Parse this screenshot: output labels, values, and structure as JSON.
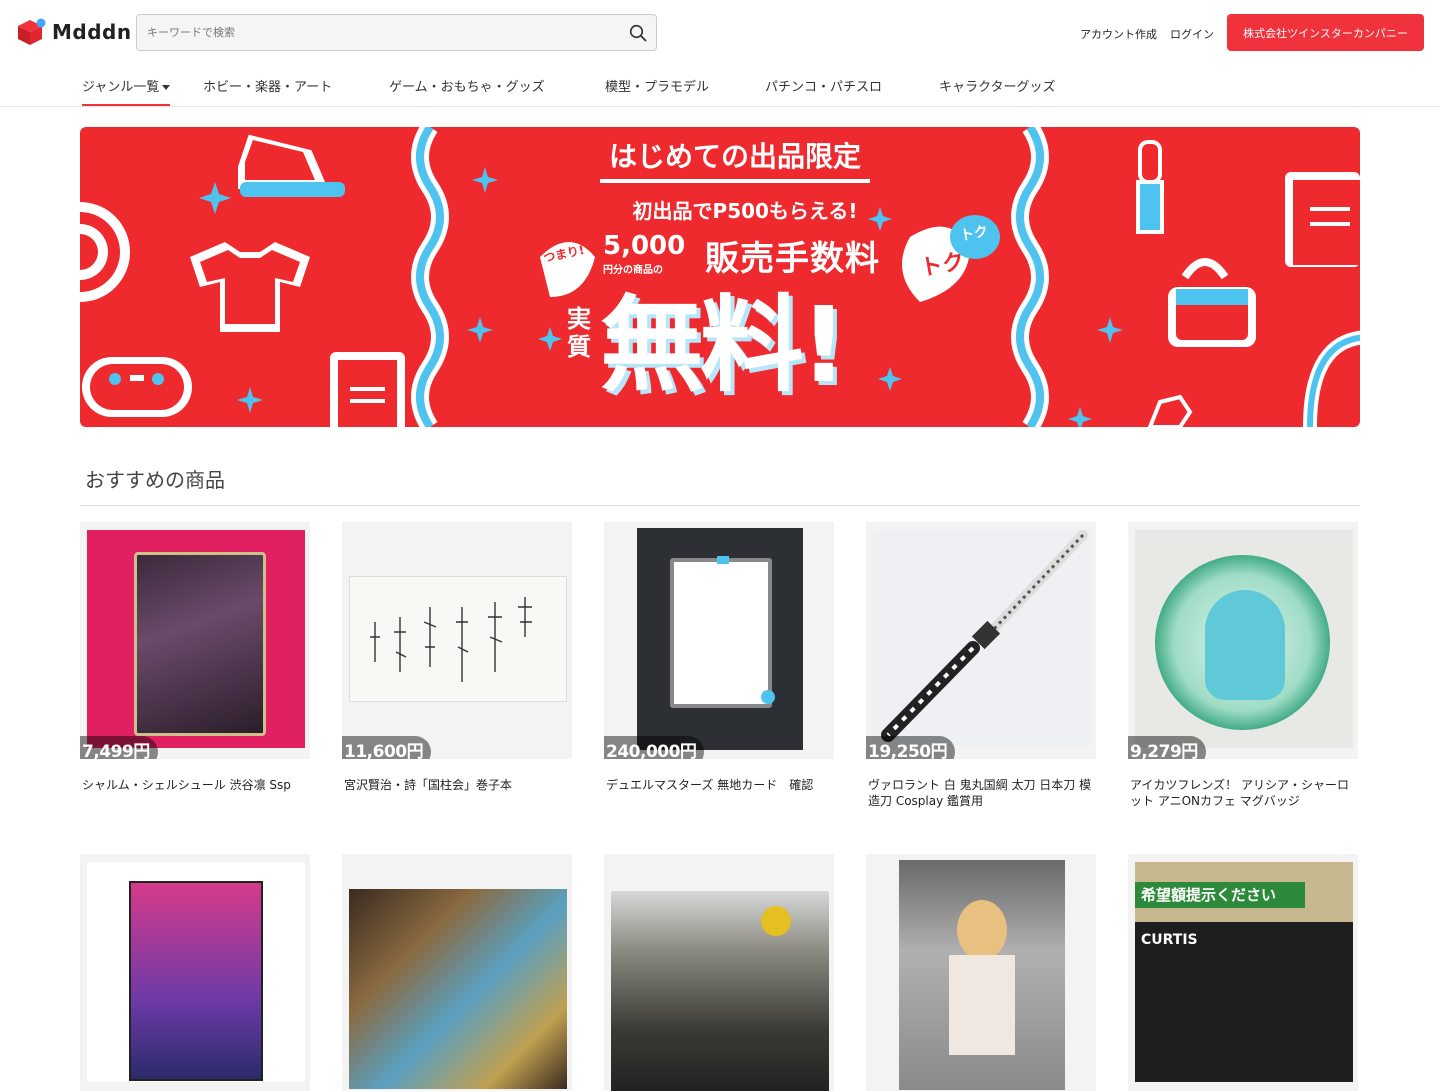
{
  "header": {
    "logo_text": "Mdddn",
    "search_placeholder": "キーワードで検索",
    "account_create": "アカウント作成",
    "login": "ログイン",
    "company_button": "株式会社ツインスターカンパニー"
  },
  "nav": {
    "items": [
      "ジャンル一覧",
      "ホビー・楽器・アート",
      "ゲーム・おもちゃ・グッズ",
      "模型・プラモデル",
      "パチンコ・パチスロ",
      "キャラクターグッズ"
    ]
  },
  "banner": {
    "headline": "はじめての出品限定",
    "line1": "初出品でP500もらえる!",
    "tsumari": "つまり!",
    "amount": "5,000",
    "amount_sub": "円分の商品の",
    "fee": "販売手数料",
    "jisshitsu": "実質",
    "free": "無料!",
    "toku1": "トク",
    "toku2": "トク"
  },
  "section": {
    "title": "おすすめの商品"
  },
  "products": [
    {
      "price": "7,499円",
      "title": "シャルム・シェルシュール 渋谷凛 Ssp"
    },
    {
      "price": "11,600円",
      "title": "宮沢賢治・詩「国柱会」巻子本"
    },
    {
      "price": "240,000円",
      "title": "デュエルマスターズ 無地カード　確認"
    },
    {
      "price": "19,250円",
      "title": "ヴァロラント 白 鬼丸国綱 太刀 日本刀 模造刀 Cosplay 鑑賞用"
    },
    {
      "price": "9,279円",
      "title": "アイカツフレンズ！ アリシア・シャーロット アニONカフェ マグバッジ"
    },
    {
      "price": "",
      "title": ""
    },
    {
      "price": "",
      "title": ""
    },
    {
      "price": "",
      "title": ""
    },
    {
      "price": "",
      "title": ""
    },
    {
      "price": "",
      "title": ""
    }
  ],
  "product_images": {
    "p5_banner": "希望額提示ください",
    "p5_text": "CURTIS"
  },
  "colors": {
    "brand_red": "#f0323c",
    "banner_red": "#ee2a2f",
    "banner_blue": "#4ec3f0"
  }
}
